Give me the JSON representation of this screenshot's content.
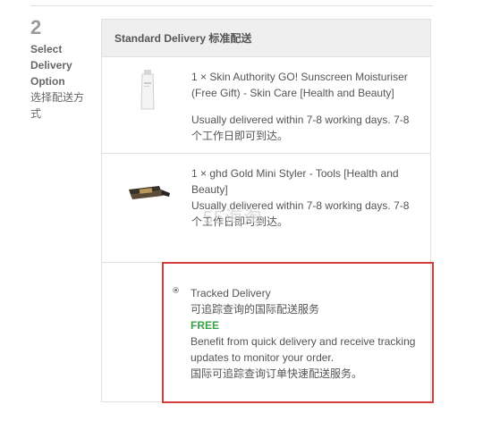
{
  "step": {
    "number": "2",
    "label": "Select Delivery Option",
    "label_cn": "选择配送方式"
  },
  "panel": {
    "header": "Standard Delivery 标准配送"
  },
  "items": [
    {
      "title": "1 × Skin Authority GO! Sunscreen Moisturiser (Free Gift) - Skin Care [Health and Beauty]",
      "delivery_note": "Usually delivered within 7-8 working days. 7-8 个工作日即可到达。"
    },
    {
      "title": "1 × ghd Gold Mini Styler - Tools [Health and Beauty]",
      "delivery_note": "Usually delivered within 7-8 working days. 7-8 个工作日即可到达。"
    }
  ],
  "watermark": "55海淘",
  "delivery_option": {
    "selected": true,
    "name": "Tracked Delivery",
    "name_cn": "可追踪查询的国际配送服务",
    "price": "FREE",
    "description": "Benefit from quick delivery and receive tracking updates to monitor your order.",
    "description_cn": "国际可追踪查询订单快速配送服务。"
  },
  "colors": {
    "highlight_border": "#d63c3c",
    "free_text": "#3aa148",
    "header_bg": "#efefef"
  }
}
